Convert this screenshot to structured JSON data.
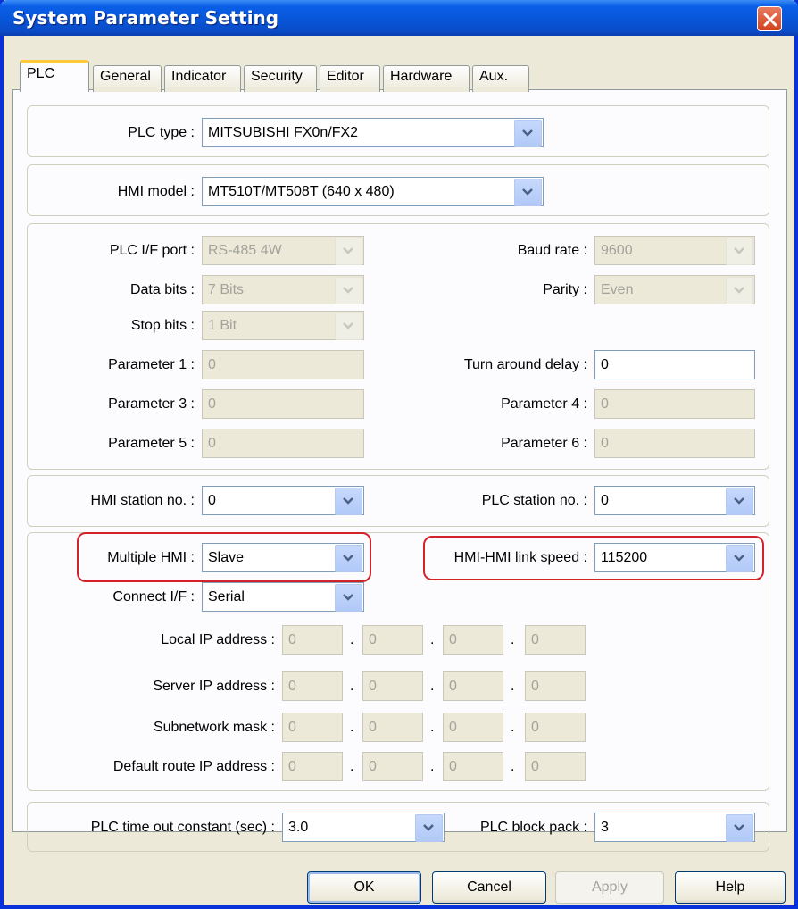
{
  "window": {
    "title": "System Parameter Setting"
  },
  "tabs": [
    "PLC",
    "General",
    "Indicator",
    "Security",
    "Editor",
    "Hardware",
    "Aux."
  ],
  "plc_type": {
    "label": "PLC type :",
    "value": "MITSUBISHI FX0n/FX2"
  },
  "hmi_model": {
    "label": "HMI model :",
    "value": "MT510T/MT508T (640 x 480)"
  },
  "comm": {
    "plc_if_port": {
      "label": "PLC I/F port :",
      "value": "RS-485 4W"
    },
    "baud_rate": {
      "label": "Baud rate :",
      "value": "9600"
    },
    "data_bits": {
      "label": "Data bits :",
      "value": "7 Bits"
    },
    "parity": {
      "label": "Parity :",
      "value": "Even"
    },
    "stop_bits": {
      "label": "Stop bits :",
      "value": "1 Bit"
    },
    "param1": {
      "label": "Parameter 1 :",
      "value": "0"
    },
    "turn_around": {
      "label": "Turn around delay :",
      "value": "0"
    },
    "param3": {
      "label": "Parameter 3 :",
      "value": "0"
    },
    "param4": {
      "label": "Parameter 4 :",
      "value": "0"
    },
    "param5": {
      "label": "Parameter 5 :",
      "value": "0"
    },
    "param6": {
      "label": "Parameter 6 :",
      "value": "0"
    }
  },
  "station": {
    "hmi": {
      "label": "HMI station no. :",
      "value": "0"
    },
    "plc": {
      "label": "PLC station no. :",
      "value": "0"
    }
  },
  "multi": {
    "multiple_hmi": {
      "label": "Multiple HMI :",
      "value": "Slave"
    },
    "link_speed": {
      "label": "HMI-HMI link speed :",
      "value": "115200"
    },
    "connect_if": {
      "label": "Connect I/F :",
      "value": "Serial"
    },
    "local_ip": {
      "label": "Local IP address :",
      "octets": [
        "0",
        "0",
        "0",
        "0"
      ]
    },
    "server_ip": {
      "label": "Server IP address :",
      "octets": [
        "0",
        "0",
        "0",
        "0"
      ]
    },
    "subnet": {
      "label": "Subnetwork mask :",
      "octets": [
        "0",
        "0",
        "0",
        "0"
      ]
    },
    "route_ip": {
      "label": "Default route IP address :",
      "octets": [
        "0",
        "0",
        "0",
        "0"
      ]
    },
    "separator": "."
  },
  "timeout": {
    "constant": {
      "label": "PLC time out constant (sec) :",
      "value": "3.0"
    },
    "block_pack": {
      "label": "PLC block pack :",
      "value": "3"
    }
  },
  "buttons": {
    "ok": "OK",
    "cancel": "Cancel",
    "apply": "Apply",
    "help": "Help"
  },
  "colors": {
    "title_bar": "#0a5ee6",
    "highlight": "#d2232a",
    "active_tab_accent": "#ffc83c"
  }
}
